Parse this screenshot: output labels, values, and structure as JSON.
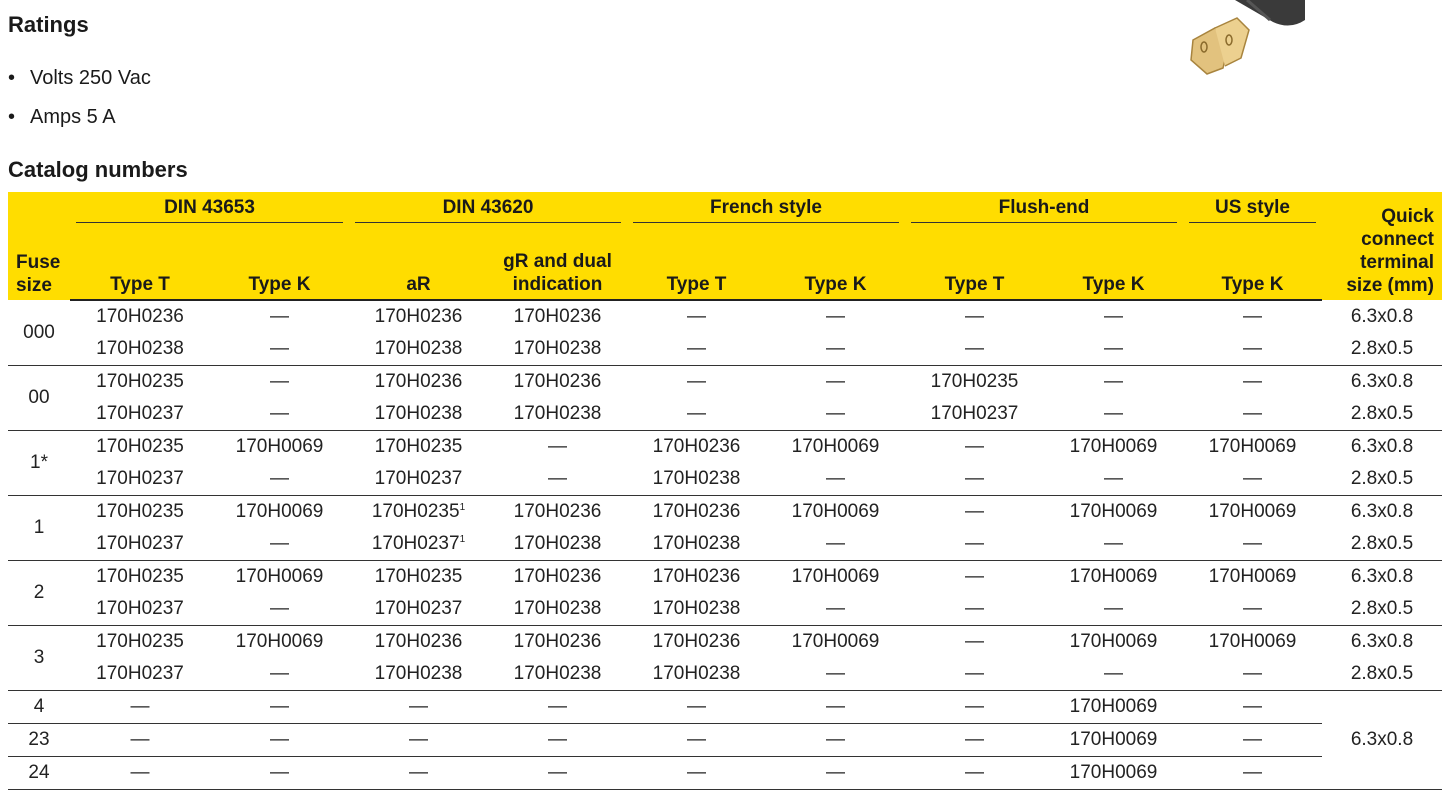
{
  "ratings": {
    "heading": "Ratings",
    "items": [
      "Volts 250 Vac",
      "Amps 5 A"
    ]
  },
  "catalog": {
    "heading": "Catalog numbers",
    "groups": [
      "DIN 43653",
      "DIN 43620",
      "French style",
      "Flush-end",
      "US style"
    ],
    "fuse_size_header": "Fuse size",
    "sub_headers": [
      "Type T",
      "Type K",
      "aR",
      "gR and dual indication",
      "Type T",
      "Type K",
      "Type T",
      "Type K",
      "Type K"
    ],
    "qc_header": "Quick connect terminal size (mm)",
    "rows": [
      {
        "fuse": "000",
        "lines": [
          [
            "170H0236",
            "—",
            "170H0236",
            "170H0236",
            "—",
            "—",
            "—",
            "—",
            "—",
            "6.3x0.8"
          ],
          [
            "170H0238",
            "—",
            "170H0238",
            "170H0238",
            "—",
            "—",
            "—",
            "—",
            "—",
            "2.8x0.5"
          ]
        ]
      },
      {
        "fuse": "00",
        "lines": [
          [
            "170H0235",
            "—",
            "170H0236",
            "170H0236",
            "—",
            "—",
            "170H0235",
            "—",
            "—",
            "6.3x0.8"
          ],
          [
            "170H0237",
            "—",
            "170H0238",
            "170H0238",
            "—",
            "—",
            "170H0237",
            "—",
            "—",
            "2.8x0.5"
          ]
        ]
      },
      {
        "fuse": "1*",
        "lines": [
          [
            "170H0235",
            "170H0069",
            "170H0235",
            "—",
            "170H0236",
            "170H0069",
            "—",
            "170H0069",
            "170H0069",
            "6.3x0.8"
          ],
          [
            "170H0237",
            "—",
            "170H0237",
            "—",
            "170H0238",
            "—",
            "—",
            "—",
            "—",
            "2.8x0.5"
          ]
        ]
      },
      {
        "fuse": "1",
        "lines": [
          [
            "170H0235",
            "170H0069",
            "170H0235¹",
            "170H0236",
            "170H0236",
            "170H0069",
            "—",
            "170H0069",
            "170H0069",
            "6.3x0.8"
          ],
          [
            "170H0237",
            "—",
            "170H0237¹",
            "170H0238",
            "170H0238",
            "—",
            "—",
            "—",
            "—",
            "2.8x0.5"
          ]
        ]
      },
      {
        "fuse": "2",
        "lines": [
          [
            "170H0235",
            "170H0069",
            "170H0235",
            "170H0236",
            "170H0236",
            "170H0069",
            "—",
            "170H0069",
            "170H0069",
            "6.3x0.8"
          ],
          [
            "170H0237",
            "—",
            "170H0237",
            "170H0238",
            "170H0238",
            "—",
            "—",
            "—",
            "—",
            "2.8x0.5"
          ]
        ]
      },
      {
        "fuse": "3",
        "lines": [
          [
            "170H0235",
            "170H0069",
            "170H0236",
            "170H0236",
            "170H0236",
            "170H0069",
            "—",
            "170H0069",
            "170H0069",
            "6.3x0.8"
          ],
          [
            "170H0237",
            "—",
            "170H0238",
            "170H0238",
            "170H0238",
            "—",
            "—",
            "—",
            "—",
            "2.8x0.5"
          ]
        ]
      }
    ],
    "single_rows": [
      {
        "fuse": "4",
        "cells": [
          "—",
          "—",
          "—",
          "—",
          "—",
          "—",
          "—",
          "170H0069",
          "—"
        ]
      },
      {
        "fuse": "23",
        "cells": [
          "—",
          "—",
          "—",
          "—",
          "—",
          "—",
          "—",
          "170H0069",
          "—"
        ]
      },
      {
        "fuse": "24",
        "cells": [
          "—",
          "—",
          "—",
          "—",
          "—",
          "—",
          "—",
          "170H0069",
          "—"
        ]
      }
    ],
    "single_rows_qc": "6.3x0.8"
  },
  "colors": {
    "header_bg": "#ffdd00",
    "text": "#1a1a1a"
  },
  "icons": {
    "product_image": "fuse-quick-connect-terminal"
  }
}
